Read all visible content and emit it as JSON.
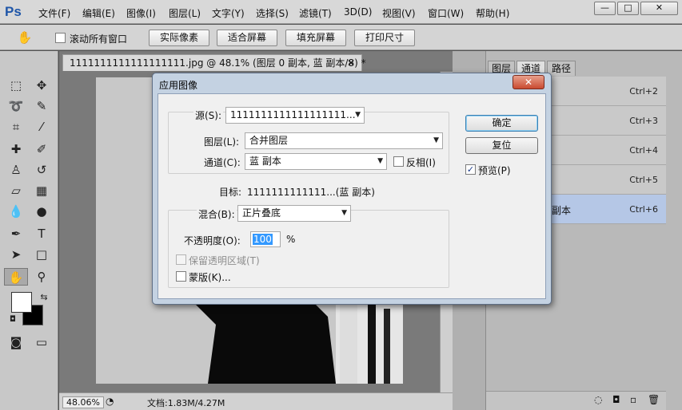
{
  "app": {
    "logo": "Ps",
    "menus": [
      "文件(F)",
      "编辑(E)",
      "图像(I)",
      "图层(L)",
      "文字(Y)",
      "选择(S)",
      "滤镜(T)",
      "3D(D)",
      "视图(V)",
      "窗口(W)",
      "帮助(H)"
    ],
    "window_controls": {
      "minimize": "—",
      "maximize": "□",
      "close": "✕"
    }
  },
  "options_bar": {
    "tool_icon": "hand-icon",
    "scroll_all_label": "滚动所有窗口",
    "buttons": [
      "实际像素",
      "适合屏幕",
      "填充屏幕",
      "打印尺寸"
    ]
  },
  "document": {
    "tab_title": "1111111111111111111.jpg @ 48.1% (图层 0 副本, 蓝 副本/8) *",
    "tab_close": "✕",
    "zoom": "48.06%",
    "doc_info": "文档:1.83M/4.27M"
  },
  "panel": {
    "tabs": [
      "图层",
      "通道",
      "路径"
    ],
    "channels": [
      {
        "name": "",
        "shortcut": "Ctrl+2"
      },
      {
        "name": "",
        "shortcut": "Ctrl+3"
      },
      {
        "name": "",
        "shortcut": "Ctrl+4"
      },
      {
        "name": "",
        "shortcut": "Ctrl+5"
      },
      {
        "name": "副本",
        "shortcut": "Ctrl+6"
      }
    ]
  },
  "dialog": {
    "title": "应用图像",
    "close": "✕",
    "source_label": "源(S):",
    "source_value": "1111111111111111111...",
    "layer_label": "图层(L):",
    "layer_value": "合并图层",
    "channel_label": "通道(C):",
    "channel_value": "蓝 副本",
    "invert_label": "反相(I)",
    "target_label": "目标:",
    "target_value": "1111111111111...(蓝 副本)",
    "blending_label": "混合(B):",
    "blending_value": "正片叠底",
    "opacity_label": "不透明度(O):",
    "opacity_value": "100",
    "opacity_unit": "%",
    "preserve_label": "保留透明区域(T)",
    "mask_label": "蒙版(K)...",
    "ok_label": "确定",
    "reset_label": "复位",
    "preview_label": "预览(P)",
    "preview_checked": "✓"
  }
}
